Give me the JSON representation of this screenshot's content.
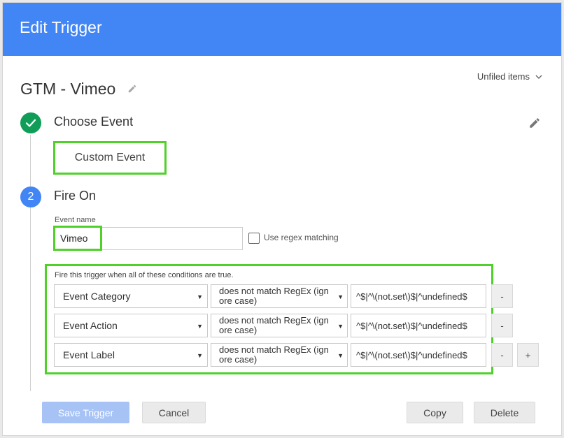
{
  "header": {
    "title": "Edit Trigger"
  },
  "folder": {
    "label": "Unfiled items"
  },
  "trigger": {
    "name": "GTM - Vimeo"
  },
  "step1": {
    "title": "Choose Event",
    "event_type": "Custom Event"
  },
  "step2": {
    "number": "2",
    "title": "Fire On",
    "event_name_label": "Event name",
    "event_name_value": "Vimeo",
    "regex_label": "Use regex matching",
    "regex_checked": false,
    "conditions_desc": "Fire this trigger when all of these conditions are true.",
    "conditions": [
      {
        "variable": "Event Category",
        "operator": "does not match RegEx (ignore case)",
        "value": "^$|^\\(not.set\\)$|^undefined$"
      },
      {
        "variable": "Event Action",
        "operator": "does not match RegEx (ignore case)",
        "value": "^$|^\\(not.set\\)$|^undefined$"
      },
      {
        "variable": "Event Label",
        "operator": "does not match RegEx (ignore case)",
        "value": "^$|^\\(not.set\\)$|^undefined$"
      }
    ],
    "remove_label": "-",
    "add_label": "+"
  },
  "footer": {
    "save_label": "Save Trigger",
    "cancel_label": "Cancel",
    "copy_label": "Copy",
    "delete_label": "Delete"
  },
  "colors": {
    "header_bg": "#4285f4",
    "step_done": "#0f9d58",
    "step_active": "#4285f4",
    "highlight": "#4fd12a"
  }
}
